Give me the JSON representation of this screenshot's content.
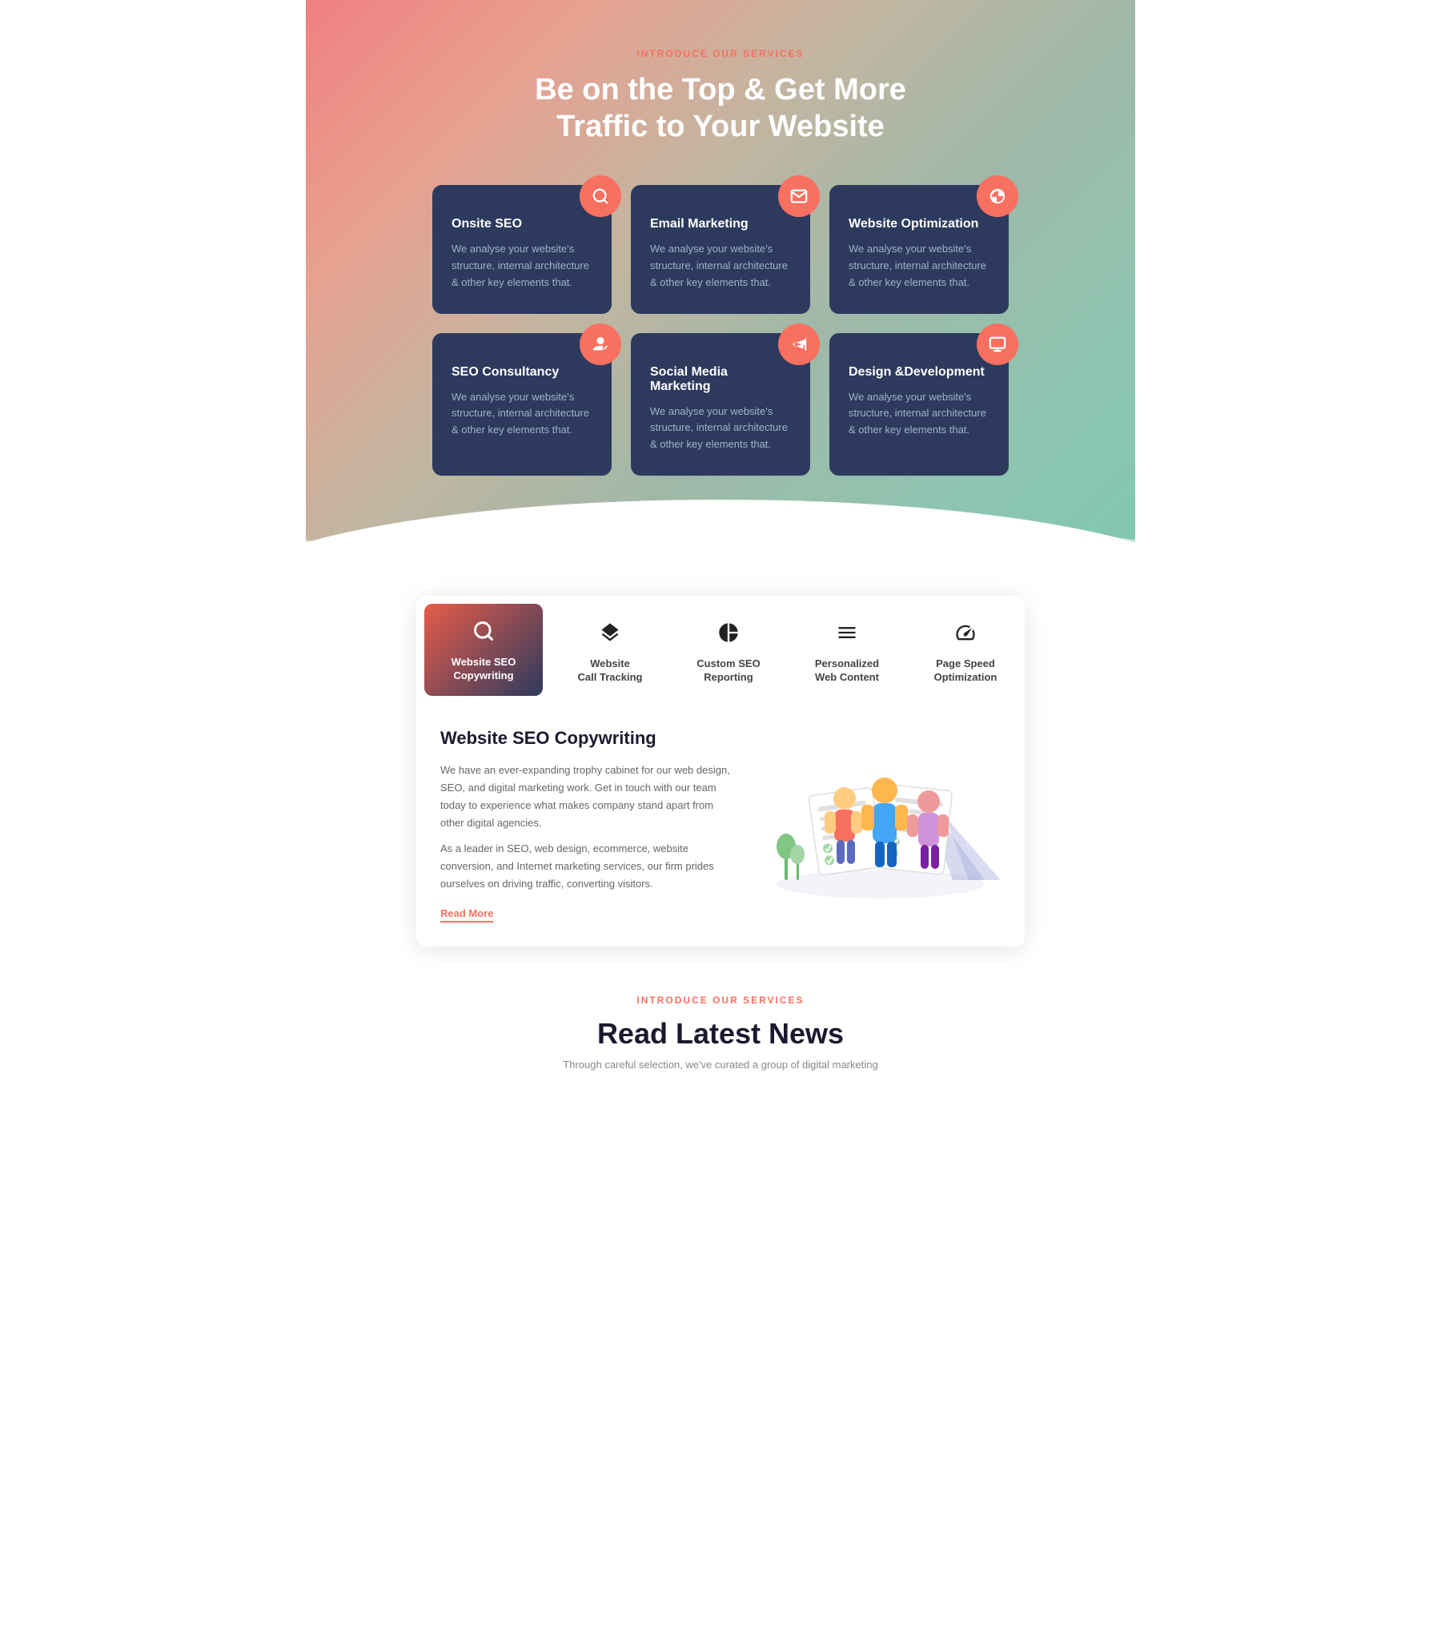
{
  "services_section": {
    "tagline": "INTRODUCE OUR SERVICES",
    "title_line1": "Be on the Top & Get More",
    "title_line2": "Traffic to Your Website",
    "cards": [
      {
        "id": "onsite-seo",
        "title": "Onsite SEO",
        "description": "We analyse your website's structure, internal architecture & other key elements that.",
        "icon": "search"
      },
      {
        "id": "email-marketing",
        "title": "Email Marketing",
        "description": "We analyse your website's structure, internal architecture & other key elements that.",
        "icon": "email"
      },
      {
        "id": "website-optimization",
        "title": "Website Optimization",
        "description": "We analyse your website's structure, internal architecture & other key elements that.",
        "icon": "pie-chart"
      },
      {
        "id": "seo-consultancy",
        "title": "SEO Consultancy",
        "description": "We analyse your website's structure, internal architecture & other key elements that.",
        "icon": "user-check"
      },
      {
        "id": "social-media",
        "title": "Social Media Marketing",
        "description": "We analyse your website's structure, internal architecture & other key elements that.",
        "icon": "megaphone"
      },
      {
        "id": "design-dev",
        "title": "Design &Development",
        "description": "We analyse your website's structure, internal architecture & other key elements that.",
        "icon": "monitor"
      }
    ]
  },
  "tabs_section": {
    "tabs": [
      {
        "id": "website-seo",
        "label_line1": "Website SEO",
        "label_line2": "Copywriting",
        "active": true
      },
      {
        "id": "call-tracking",
        "label_line1": "Website",
        "label_line2": "Call Tracking",
        "active": false
      },
      {
        "id": "custom-seo",
        "label_line1": "Custom SEO",
        "label_line2": "Reporting",
        "active": false
      },
      {
        "id": "web-content",
        "label_line1": "Personalized",
        "label_line2": "Web Content",
        "active": false
      },
      {
        "id": "page-speed",
        "label_line1": "Page Speed",
        "label_line2": "Optimization",
        "active": false
      }
    ],
    "active_content": {
      "title": "Website SEO Copywriting",
      "paragraph1": "We have an ever-expanding trophy cabinet for our web design, SEO, and digital marketing work. Get in touch with our team today to experience what makes company stand apart from other digital agencies.",
      "paragraph2": "As a leader in SEO, web design, ecommerce, website conversion, and Internet marketing services, our firm prides ourselves on driving traffic, converting visitors.",
      "read_more": "Read More"
    }
  },
  "news_section": {
    "tagline": "INTRODUCE OUR SERVICES",
    "title": "Read Latest News",
    "subtitle": "Through careful selection, we've curated a group of digital marketing"
  },
  "icons": {
    "search": "🔍",
    "email": "✉",
    "pie_chart": "◕",
    "user_check": "👤",
    "megaphone": "📣",
    "monitor": "🖥",
    "layers": "⊞",
    "chart": "◑",
    "document": "≡",
    "speedometer": "⊙"
  }
}
